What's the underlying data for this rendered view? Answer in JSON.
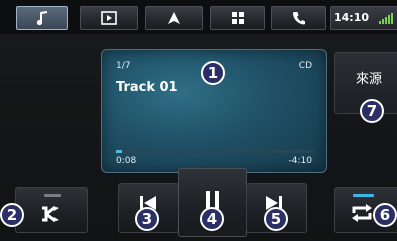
{
  "tabs": [
    {
      "icon": "music-note-icon",
      "active": true
    },
    {
      "icon": "play-square-icon",
      "active": false
    },
    {
      "icon": "navigation-arrow-icon",
      "active": false
    },
    {
      "icon": "grid-icon",
      "active": false
    },
    {
      "icon": "phone-icon",
      "active": false
    }
  ],
  "status": {
    "time": "14:10"
  },
  "player": {
    "track_position": "1/7",
    "source_type": "CD",
    "track_title": "Track 01",
    "elapsed": "0:08",
    "remaining": "-4:10",
    "progress_fraction": 0.03
  },
  "source_button": {
    "label": "來源"
  },
  "controls": {
    "shuffle_icon": "shuffle-icon",
    "prev_icon": "skip-previous-icon",
    "pause_icon": "pause-icon",
    "next_icon": "skip-next-icon",
    "repeat_icon": "repeat-icon",
    "repeat_indicator_color": "#3db5e6",
    "shuffle_indicator_color": "#7a7f86"
  },
  "callouts": {
    "c1": "1",
    "c2": "2",
    "c3": "3",
    "c4": "4",
    "c5": "5",
    "c6": "6",
    "c7": "7"
  }
}
